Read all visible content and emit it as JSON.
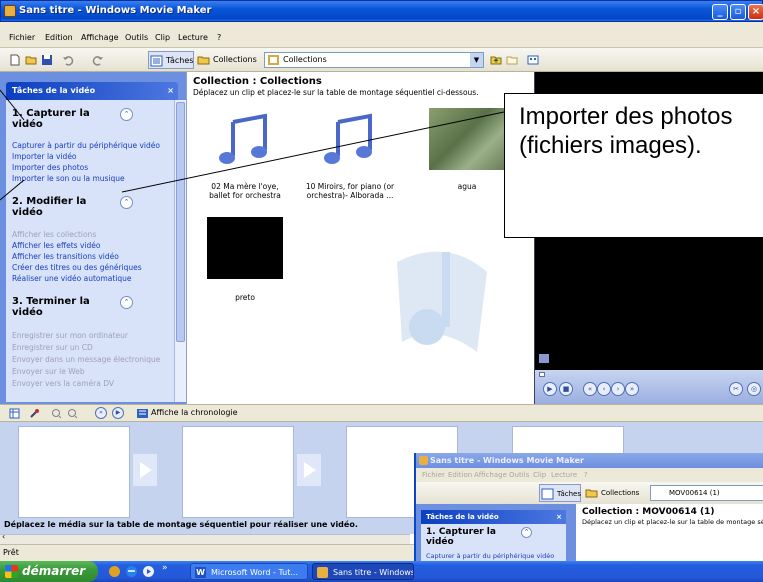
{
  "window": {
    "title": "Sans titre - Windows Movie Maker"
  },
  "menu": [
    "Fichier",
    "Edition",
    "Affichage",
    "Outils",
    "Clip",
    "Lecture",
    "?"
  ],
  "toolbar": {
    "tasks_label": "Tâches",
    "collections_label": "Collections",
    "collection_select": "Collections"
  },
  "taskpane": {
    "header": "Tâches de la vidéo",
    "close": "×",
    "sections": [
      {
        "title": "1. Capturer la vidéo",
        "toggle": "⌃",
        "links": [
          "Capturer à partir du périphérique vidéo",
          "Importer la vidéo",
          "Importer des photos",
          "Importer le son ou la musique"
        ]
      },
      {
        "title": "2. Modifier la vidéo",
        "toggle": "⌃",
        "links": [
          "Afficher les collections",
          "Afficher les effets vidéo",
          "Afficher les transitions vidéo",
          "Créer des titres ou des génériques",
          "Réaliser une vidéo automatique"
        ]
      },
      {
        "title": "3. Terminer la vidéo",
        "toggle": "⌃",
        "links": [
          "Enregistrer sur mon ordinateur",
          "Enregistrer sur un CD",
          "Envoyer dans un message électronique",
          "Envoyer sur le Web",
          "Envoyer vers la caméra DV"
        ]
      }
    ]
  },
  "collection": {
    "heading": "Collection : Collections",
    "subtitle": "Déplacez un clip et placez-le sur la table de montage séquentiel ci-dessous.",
    "clips": [
      {
        "name": "02 Ma mère l'oye, ballet for orchestra",
        "kind": "music-note-icon"
      },
      {
        "name": "10 Miroirs, for piano (or orchestra)- Alborada ...",
        "kind": "music-note-icon"
      },
      {
        "name": "agua",
        "kind": "photo"
      },
      {
        "name": "preto",
        "kind": "black"
      }
    ]
  },
  "timeline": {
    "show_timeline": "Affiche la chronologie"
  },
  "storyboard": {
    "message": "Déplacez le média sur la table de montage séquentiel pour réaliser une vidéo."
  },
  "status": {
    "text": "Prêt"
  },
  "taskbar": {
    "start": "démarrer",
    "tasks": [
      "Microsoft Word - Tut...",
      "Sans titre - Windows ..."
    ]
  },
  "inset": {
    "title": "Sans titre - Windows Movie Maker",
    "menu": [
      "Fichier",
      "Edition",
      "Affichage",
      "Outils",
      "Clip",
      "Lecture",
      "?"
    ],
    "tasks_label": "Tâches",
    "collections_label": "Collections",
    "collection_select": "MOV00614 (1)",
    "pane_header": "Tâches de la vidéo",
    "pane_close": "×",
    "section_title": "1. Capturer la vidéo",
    "section_toggle": "⌃",
    "first_link": "Capturer à partir du périphérique vidéo",
    "heading": "Collection : MOV00614 (1)",
    "subtitle": "Déplacez un clip et placez-le sur la table de montage séq"
  },
  "callout": {
    "text": "Importer des photos (fichiers images)."
  }
}
